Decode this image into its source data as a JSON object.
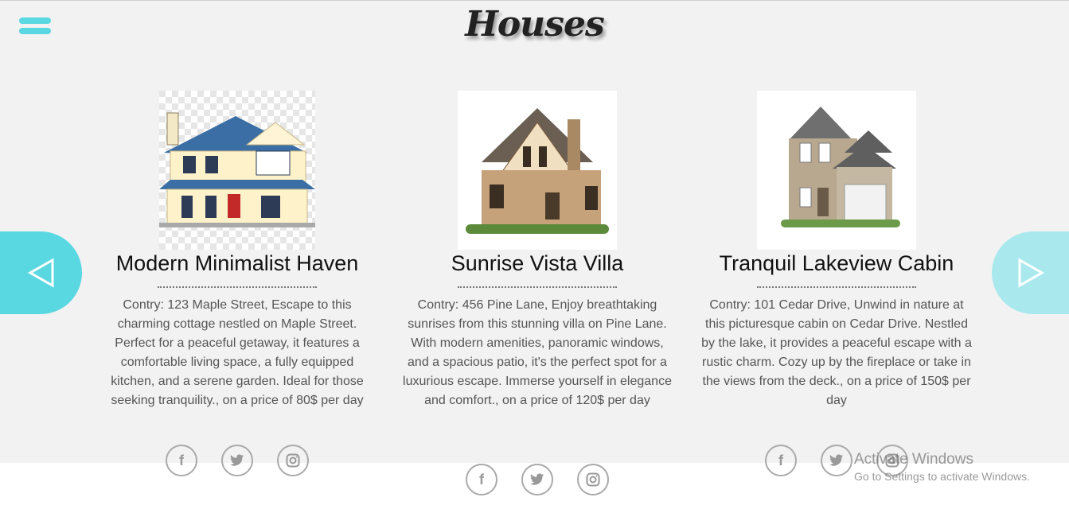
{
  "header": {
    "title": "Houses"
  },
  "menu": {
    "icon": "hamburger-menu-icon"
  },
  "nav": {
    "prev_icon": "chevron-left-outline-icon",
    "next_icon": "chevron-right-outline-icon"
  },
  "colors": {
    "accent": "#5ad8e2",
    "accent_light": "#a9e9ee",
    "panel": "#f2f2f2"
  },
  "cards": [
    {
      "name": "Modern Minimalist Haven",
      "description": "Contry: 123 Maple Street, Escape to this charming cottage nestled on Maple Street. Perfect for a peaceful getaway, it features a comfortable living space, a fully equipped kitchen, and a serene garden. Ideal for those seeking tranquility., on a price of 80$ per day"
    },
    {
      "name": "Sunrise Vista Villa",
      "description": "Contry: 456 Pine Lane, Enjoy breathtaking sunrises from this stunning villa on Pine Lane. With modern amenities, panoramic windows, and a spacious patio, it's the perfect spot for a luxurious escape. Immerse yourself in elegance and comfort., on a price of 120$ per day"
    },
    {
      "name": "Tranquil Lakeview Cabin",
      "description": "Contry:  101 Cedar Drive, Unwind in nature at this picturesque cabin on Cedar Drive. Nestled by the lake, it provides a peaceful escape with a rustic charm. Cozy up by the fireplace or take in the views from the deck., on a price of 150$ per day"
    }
  ],
  "social": {
    "facebook": "f",
    "twitter": "t",
    "instagram": "i"
  },
  "watermark": {
    "line1": "Activate Windows",
    "line2": "Go to Settings to activate Windows."
  }
}
